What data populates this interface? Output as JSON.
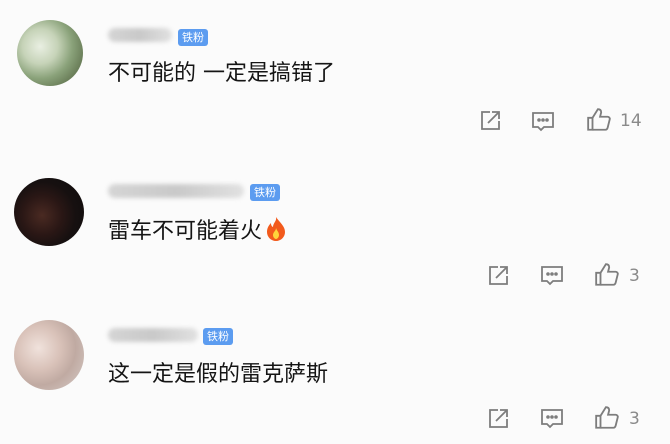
{
  "comments": [
    {
      "badge": "铁粉",
      "text": "不可能的 一定是搞错了",
      "like_count": "14",
      "avatar": "blurred-photo-avatar",
      "emoji": ""
    },
    {
      "badge": "铁粉",
      "text": "雷车不可能着火",
      "like_count": "3",
      "avatar": "dark-photo-avatar",
      "emoji": "fire-emoji"
    },
    {
      "badge": "铁粉",
      "text": "这一定是假的雷克萨斯",
      "like_count": "3",
      "avatar": "light-photo-avatar",
      "emoji": ""
    }
  ],
  "icons": {
    "share": "share-icon",
    "reply": "comment-icon",
    "like": "thumbs-up-icon"
  },
  "colors": {
    "badge": "#5c9cf0",
    "text": "#151515",
    "meta": "#8a8a8a",
    "background": "#fbfbfb"
  }
}
